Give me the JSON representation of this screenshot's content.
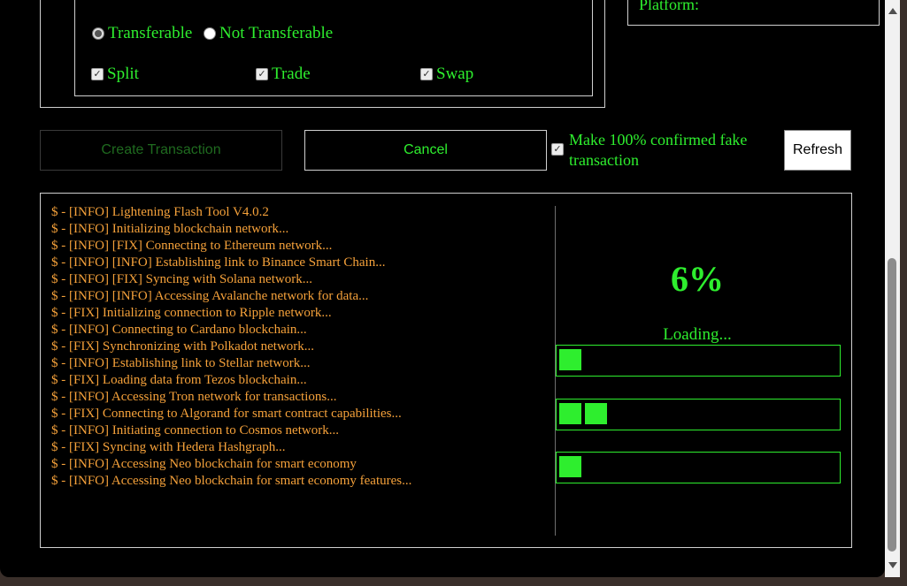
{
  "options": {
    "side_label": "Platform:",
    "radios": [
      {
        "label": "Transferable",
        "checked": true
      },
      {
        "label": "Not Transferable",
        "checked": false
      }
    ],
    "checkboxes": [
      {
        "label": "Split",
        "checked": true
      },
      {
        "label": "Trade",
        "checked": true
      },
      {
        "label": "Swap",
        "checked": true
      }
    ]
  },
  "actions": {
    "create_label": "Create Transaction",
    "cancel_label": "Cancel",
    "fake_label": "Make 100% confirmed fake transaction",
    "fake_checked": true,
    "refresh_label": "Refresh"
  },
  "console": {
    "log": [
      "$ - [INFO] Lightening Flash Tool V4.0.2",
      "$ - [INFO] Initializing blockchain network...",
      "$ - [INFO] [FIX] Connecting to Ethereum network...",
      "$ - [INFO] [INFO] Establishing link to Binance Smart Chain...",
      "$ - [INFO] [FIX] Syncing with Solana network...",
      "$ - [INFO] [INFO] Accessing Avalanche network for data...",
      "$ - [FIX] Initializing connection to Ripple network...",
      "$ - [INFO] Connecting to Cardano blockchain...",
      "$ - [FIX] Synchronizing with Polkadot network...",
      "$ - [INFO] Establishing link to Stellar network...",
      "$ - [FIX] Loading data from Tezos blockchain...",
      "$ - [INFO] Accessing Tron network for transactions...",
      "$ - [FIX] Connecting to Algorand for smart contract capabilities...",
      "$ - [INFO] Initiating connection to Cosmos network...",
      "$ - [FIX] Syncing with Hedera Hashgraph...",
      "$ - [INFO] Accessing Neo blockchain for smart economy",
      "$ - [INFO] Accessing Neo blockchain for smart economy features..."
    ],
    "percent": "6%",
    "loading": "Loading...",
    "bars": [
      {
        "blocks": 1
      },
      {
        "blocks": 2
      },
      {
        "blocks": 1
      }
    ]
  },
  "colors": {
    "accent": "#2eee2e",
    "log": "#f5a13a",
    "background": "#000000"
  }
}
